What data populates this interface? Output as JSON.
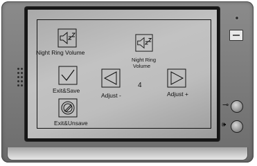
{
  "menu": {
    "night_ring_volume_label": "Night Ring Volume",
    "night_ring_volume_small_label_line1": "Night Ring",
    "night_ring_volume_small_label_line2": "Volume",
    "exit_save_label": "Exit&Save",
    "adjust_minus_label": "Adjust -",
    "adjust_plus_label": "Adjust +",
    "exit_unsave_label": "Exit&Unsave",
    "current_value": "4"
  },
  "icons": {
    "night_ring": "speaker-zz-icon",
    "exit_save": "checkmark-icon",
    "adjust_minus": "left-triangle-icon",
    "adjust_plus": "right-triangle-icon",
    "exit_unsave": "cancel-circle-icon",
    "unlock": "key-icon",
    "talk": "speaker-sound-icon"
  },
  "colors": {
    "housing": "#7a7a7a",
    "screen": "#bdbdbd",
    "bezel": "#161616"
  }
}
